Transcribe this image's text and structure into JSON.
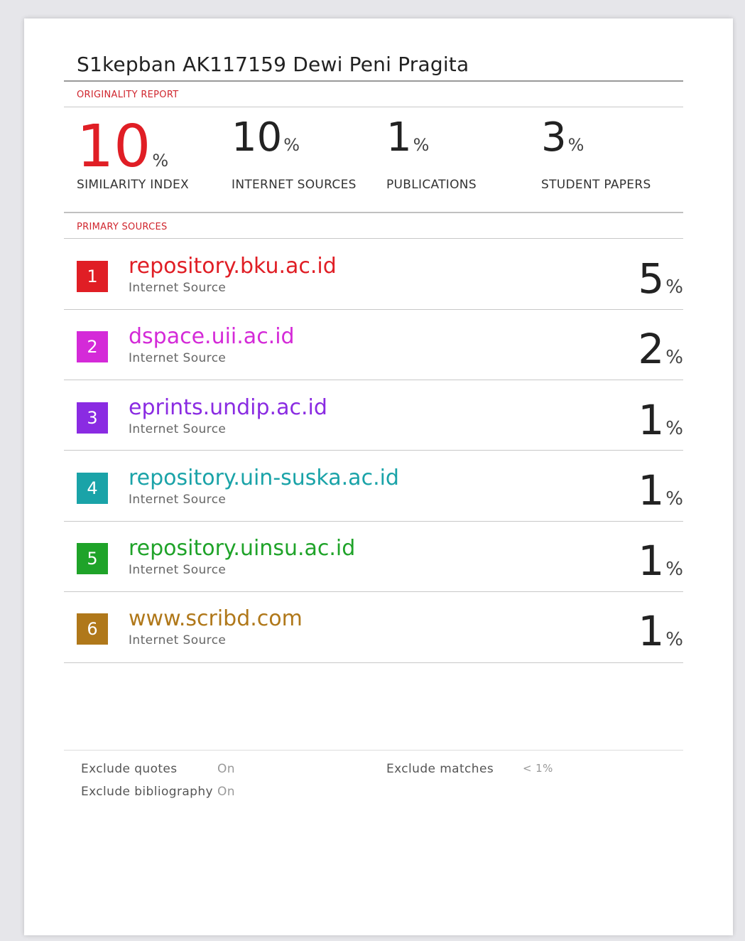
{
  "report": {
    "title": "S1kepban AK117159 Dewi Peni Pragita",
    "originality_label": "ORIGINALITY REPORT",
    "primary_sources_label": "PRIMARY SOURCES"
  },
  "stats": [
    {
      "value": "10",
      "pct": "%",
      "label": "SIMILARITY INDEX"
    },
    {
      "value": "10",
      "pct": "%",
      "label": "INTERNET SOURCES"
    },
    {
      "value": "1",
      "pct": "%",
      "label": "PUBLICATIONS"
    },
    {
      "value": "3",
      "pct": "%",
      "label": "STUDENT PAPERS"
    }
  ],
  "sources": [
    {
      "rank": "1",
      "name": "repository.bku.ac.id",
      "type": "Internet Source",
      "pct_value": "5",
      "pct": "%",
      "color": "#e01e25"
    },
    {
      "rank": "2",
      "name": "dspace.uii.ac.id",
      "type": "Internet Source",
      "pct_value": "2",
      "pct": "%",
      "color": "#d42ad8"
    },
    {
      "rank": "3",
      "name": "eprints.undip.ac.id",
      "type": "Internet Source",
      "pct_value": "1",
      "pct": "%",
      "color": "#8a2be2"
    },
    {
      "rank": "4",
      "name": "repository.uin-suska.ac.id",
      "type": "Internet Source",
      "pct_value": "1",
      "pct": "%",
      "color": "#1aa3a8"
    },
    {
      "rank": "5",
      "name": "repository.uinsu.ac.id",
      "type": "Internet Source",
      "pct_value": "1",
      "pct": "%",
      "color": "#1fa329"
    },
    {
      "rank": "6",
      "name": "www.scribd.com",
      "type": "Internet Source",
      "pct_value": "1",
      "pct": "%",
      "color": "#b0781a"
    }
  ],
  "footer": {
    "exclude_quotes_label": "Exclude quotes",
    "exclude_quotes_value": "On",
    "exclude_bibliography_label": "Exclude bibliography",
    "exclude_bibliography_value": "On",
    "exclude_matches_label": "Exclude matches",
    "exclude_matches_value": "< 1%"
  }
}
